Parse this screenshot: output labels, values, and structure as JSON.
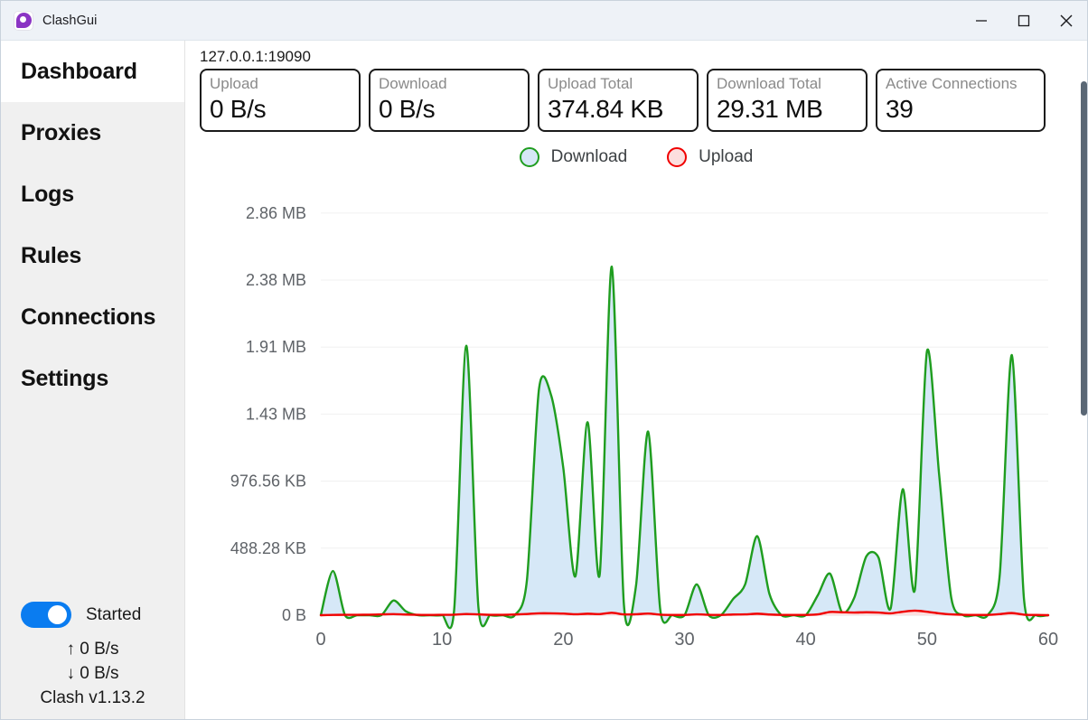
{
  "window": {
    "title": "ClashGui",
    "logo_icon": "clash-pin-icon",
    "controls": {
      "minimize": "minimize-icon",
      "maximize": "maximize-icon",
      "close": "close-icon"
    }
  },
  "sidebar": {
    "items": [
      {
        "label": "Dashboard",
        "active": true
      },
      {
        "label": "Proxies",
        "active": false
      },
      {
        "label": "Logs",
        "active": false
      },
      {
        "label": "Rules",
        "active": false
      },
      {
        "label": "Connections",
        "active": false
      },
      {
        "label": "Settings",
        "active": false
      }
    ],
    "footer": {
      "toggle_state": "on",
      "toggle_label": "Started",
      "upload_rate": "↑ 0 B/s",
      "download_rate": "↓ 0 B/s",
      "version": "Clash v1.13.2"
    }
  },
  "main": {
    "endpoint": "127.0.0.1:19090",
    "cards": [
      {
        "label": "Upload",
        "value": "0 B/s"
      },
      {
        "label": "Download",
        "value": "0 B/s"
      },
      {
        "label": "Upload Total",
        "value": "374.84 KB"
      },
      {
        "label": "Download Total",
        "value": "29.31 MB"
      },
      {
        "label": "Active Connections",
        "value": "39"
      }
    ],
    "legend": [
      {
        "label": "Download",
        "fill": "#d6e8f7",
        "stroke": "#1f9d1f"
      },
      {
        "label": "Upload",
        "fill": "#fcdede",
        "stroke": "#f00000"
      }
    ]
  },
  "chart_data": {
    "type": "area",
    "title": "",
    "xlabel": "",
    "ylabel": "",
    "grid": true,
    "legend_position": "top-center",
    "xlim": [
      0,
      60
    ],
    "ylim": [
      0,
      3100000
    ],
    "xticks": [
      0,
      10,
      20,
      30,
      40,
      50,
      60
    ],
    "xtick_labels": [
      "0",
      "10",
      "20",
      "30",
      "40",
      "50",
      "60"
    ],
    "yticks": [
      0,
      500000,
      1000000,
      1500000,
      2000000,
      2500000,
      3000000
    ],
    "ytick_labels": [
      "0 B",
      "488.28 KB",
      "976.56 KB",
      "1.43 MB",
      "1.91 MB",
      "2.38 MB",
      "2.86 MB"
    ],
    "y_unit": "bytes per second",
    "series": [
      {
        "name": "Download",
        "stroke": "#1f9d1f",
        "fill": "#d6e8f7",
        "x": [
          0,
          1,
          2,
          3,
          4,
          5,
          6,
          7,
          8,
          9,
          10,
          11,
          12,
          13,
          14,
          15,
          16,
          17,
          18,
          19,
          20,
          21,
          22,
          23,
          24,
          25,
          26,
          27,
          28,
          29,
          30,
          31,
          32,
          33,
          34,
          35,
          36,
          37,
          38,
          39,
          40,
          41,
          42,
          43,
          44,
          45,
          46,
          47,
          48,
          49,
          50,
          51,
          52,
          53,
          54,
          55,
          56,
          57,
          58,
          59,
          60
        ],
        "values": [
          0,
          330000,
          0,
          0,
          0,
          0,
          110000,
          30000,
          0,
          0,
          0,
          40000,
          2010000,
          60000,
          0,
          0,
          0,
          260000,
          1690000,
          1640000,
          1100000,
          290000,
          1440000,
          300000,
          2600000,
          80000,
          220000,
          1370000,
          40000,
          0,
          0,
          230000,
          0,
          0,
          120000,
          230000,
          590000,
          160000,
          0,
          0,
          0,
          150000,
          310000,
          20000,
          130000,
          440000,
          430000,
          50000,
          940000,
          190000,
          1970000,
          1050000,
          130000,
          0,
          0,
          0,
          300000,
          1940000,
          120000,
          0,
          0
        ]
      },
      {
        "name": "Upload",
        "stroke": "#f00000",
        "fill": "#fcdede",
        "x": [
          0,
          1,
          2,
          3,
          4,
          5,
          6,
          7,
          8,
          9,
          10,
          11,
          12,
          13,
          14,
          15,
          16,
          17,
          18,
          19,
          20,
          21,
          22,
          23,
          24,
          25,
          26,
          27,
          28,
          29,
          30,
          31,
          32,
          33,
          34,
          35,
          36,
          37,
          38,
          39,
          40,
          41,
          42,
          43,
          44,
          45,
          46,
          47,
          48,
          49,
          50,
          51,
          52,
          53,
          54,
          55,
          56,
          57,
          58,
          59,
          60
        ],
        "values": [
          0,
          2000,
          3000,
          3000,
          4000,
          6000,
          8000,
          5000,
          3000,
          2000,
          3000,
          4000,
          9000,
          6000,
          3000,
          3000,
          5000,
          9000,
          14000,
          14000,
          12000,
          7000,
          11000,
          8000,
          18000,
          6000,
          7000,
          12000,
          4000,
          2000,
          2000,
          6000,
          3000,
          2000,
          5000,
          6000,
          11000,
          5000,
          2000,
          2000,
          2000,
          6000,
          24000,
          22000,
          20000,
          22000,
          20000,
          14000,
          26000,
          34000,
          26000,
          14000,
          6000,
          3000,
          2000,
          2000,
          8000,
          16000,
          4000,
          2000,
          0
        ]
      }
    ]
  }
}
